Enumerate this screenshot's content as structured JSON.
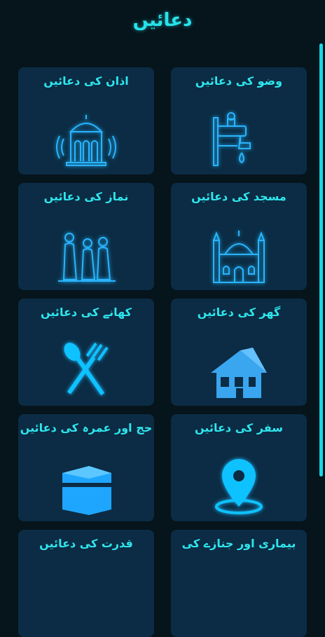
{
  "header": {
    "title": "دعائیں"
  },
  "cards": [
    {
      "label": "وضو کی دعائیں",
      "icon": "water-tap-icon"
    },
    {
      "label": "اذان کی دعائیں",
      "icon": "mosque-speaker-icon"
    },
    {
      "label": "مسجد کی دعائیں",
      "icon": "mosque-icon"
    },
    {
      "label": "نماز کی دعائیں",
      "icon": "praying-men-icon"
    },
    {
      "label": "گھر کی دعائیں",
      "icon": "house-icon"
    },
    {
      "label": "کھانے کی دعائیں",
      "icon": "spoon-fork-icon"
    },
    {
      "label": "سفر کی دعائیں",
      "icon": "location-pin-icon"
    },
    {
      "label": "حج اور عمرہ کی دعائیں",
      "icon": "kaaba-icon"
    },
    {
      "label": "بیماری اور جنازے کی",
      "icon": "illness-icon"
    },
    {
      "label": "قدرت کی دعائیں",
      "icon": "nature-icon"
    }
  ],
  "colors": {
    "accent": "#27e3ea",
    "card": "#0b2c44",
    "background": "#06141c",
    "icon": "#1fb8ff"
  }
}
